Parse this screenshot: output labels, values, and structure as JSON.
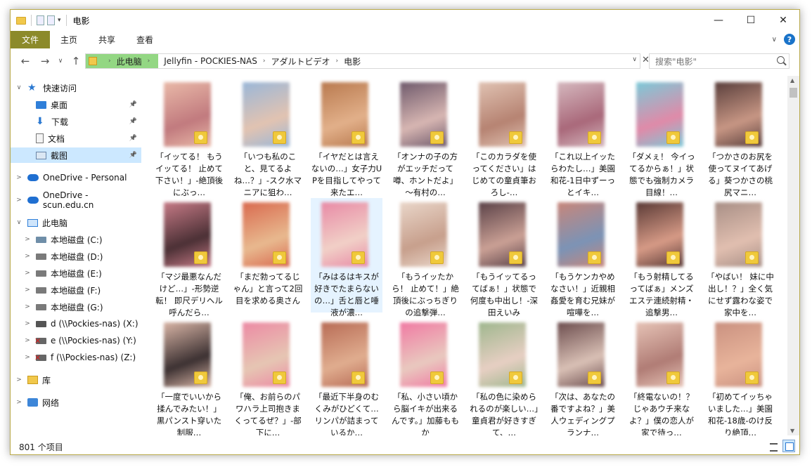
{
  "window": {
    "title": "电影",
    "controls": {
      "minimize": "—",
      "maximize": "☐",
      "close": "✕"
    }
  },
  "ribbon": {
    "tabs": [
      "文件",
      "主页",
      "共享",
      "查看"
    ],
    "help": "?"
  },
  "address": {
    "crumbs": [
      "此电脑",
      "Jellyfin - POCKIES-NAS",
      "アダルトビデオ",
      "电影"
    ],
    "search_placeholder": "搜索\"电影\""
  },
  "sidebar": {
    "items": [
      {
        "label": "快速访问",
        "icon": "star-icon",
        "expander": "∨",
        "pinned": false
      },
      {
        "label": "桌面",
        "icon": "desktop-icon",
        "pinned": true
      },
      {
        "label": "下载",
        "icon": "download-icon",
        "pinned": true
      },
      {
        "label": "文档",
        "icon": "document-icon",
        "pinned": true
      },
      {
        "label": "截图",
        "icon": "pictures-icon",
        "pinned": true,
        "selected": true
      },
      {
        "label": "OneDrive - Personal",
        "icon": "onedrive-icon",
        "expander": ">"
      },
      {
        "label": "OneDrive - scun.edu.cn",
        "icon": "onedrive-icon",
        "expander": ">"
      },
      {
        "label": "此电脑",
        "icon": "pc-icon",
        "expander": "∨"
      },
      {
        "label": "本地磁盘 (C:)",
        "icon": "windows-drive-icon",
        "expander": ">"
      },
      {
        "label": "本地磁盘 (D:)",
        "icon": "drive-icon",
        "expander": ">"
      },
      {
        "label": "本地磁盘 (E:)",
        "icon": "drive-icon",
        "expander": ">"
      },
      {
        "label": "本地磁盘 (F:)",
        "icon": "drive-icon",
        "expander": ">"
      },
      {
        "label": "本地磁盘 (G:)",
        "icon": "drive-icon",
        "expander": ">"
      },
      {
        "label": "d (\\\\Pockies-nas) (X:)",
        "icon": "network-drive-icon",
        "expander": ">"
      },
      {
        "label": "e (\\\\Pockies-nas) (Y:)",
        "icon": "disconnected-network-drive-icon",
        "expander": ">"
      },
      {
        "label": "f (\\\\Pockies-nas) (Z:)",
        "icon": "disconnected-network-drive-icon",
        "expander": ">"
      },
      {
        "label": "库",
        "icon": "library-icon",
        "expander": ">"
      },
      {
        "label": "网络",
        "icon": "network-icon",
        "expander": ">"
      }
    ]
  },
  "files": [
    {
      "caption": "「イッてる！ もうイッてる！ 止めて下さい！」-絶頂後にぶっ…",
      "colors": [
        "#e9b9a8",
        "#c17a7e"
      ]
    },
    {
      "caption": "「いつも私のこと、見てるよね…？」-スク水マニアに狙わ…",
      "colors": [
        "#9ab7d8",
        "#e2c3b1"
      ]
    },
    {
      "caption": "「イヤだとは言えないの…」女子力UPを目指してやって来たエ…",
      "colors": [
        "#b97a4f",
        "#e2b08a"
      ]
    },
    {
      "caption": "「オンナの子の方がエッチだって噂、ホントだよ」～有村の…",
      "colors": [
        "#6f5a6c",
        "#d7b6b2"
      ]
    },
    {
      "caption": "「このカラダを使ってください」はじめての童貞筆おろし-…",
      "colors": [
        "#e0c2b2",
        "#b68372"
      ]
    },
    {
      "caption": "「これ以上イッたらわたし…」美園和花-1日中ずーっとイキ…",
      "colors": [
        "#d5b8be",
        "#a9687a"
      ]
    },
    {
      "caption": "「ダメぇ！ 今イってるからぁ！」状態でも強制カメラ目線！…",
      "colors": [
        "#7cc9d8",
        "#e08aa8"
      ]
    },
    {
      "caption": "「つかさのお尻を使ってヌイてあげる」葵つかさの桃尻マニ…",
      "colors": [
        "#5a3f3c",
        "#c79684"
      ]
    },
    {
      "caption": "「マジ最悪なんだけど…」-形勢逆転！ 即尺デリヘル呼んだら…",
      "colors": [
        "#c67a86",
        "#4b3035"
      ]
    },
    {
      "caption": "「まだ勃ってるじゃん」と言って2回目を求める奥さん",
      "colors": [
        "#d96a4f",
        "#e8b98f"
      ]
    },
    {
      "caption": "「みはるはキスが好きでたまらないの…」舌と唇と唾液が濃…",
      "colors": [
        "#e88aa6",
        "#f1d0c7"
      ],
      "selected": true
    },
    {
      "caption": "「もうイッたから！ 止めて！」絶頂後にぶっちぎりの追撃弾…",
      "colors": [
        "#e9d6c9",
        "#c79f8c"
      ]
    },
    {
      "caption": "「もうイッてるってばぁ！」状態で何度も中出し！-深田えいみ",
      "colors": [
        "#5b4248",
        "#caa095"
      ]
    },
    {
      "caption": "「もうケンカやめなさい！」近親相姦愛を育む兄妹が喧嘩を…",
      "colors": [
        "#c8867a",
        "#7b93b6"
      ]
    },
    {
      "caption": "「もう射精してるってばぁ」メンズエステ連続射精・追撃男…",
      "colors": [
        "#5a3a36",
        "#d69a86"
      ]
    },
    {
      "caption": "「やばい！ 妹に中出し！？」全く気にせず露わな姿で家中を…",
      "colors": [
        "#a88f86",
        "#e1bfb0"
      ]
    },
    {
      "caption": "「一度でいいから揉んでみたい！」黒パンスト穿いた制服…",
      "colors": [
        "#d9b5a6",
        "#3c3132"
      ]
    },
    {
      "caption": "「俺、お前らのパワハラ上司抱きまくってるぜ？」-部下に…",
      "colors": [
        "#ec8aa4",
        "#e6c6b3"
      ]
    },
    {
      "caption": "「最近下半身のむくみがひどくて…リンパが詰まっているか…",
      "colors": [
        "#b86c56",
        "#e0ad8f"
      ]
    },
    {
      "caption": "「私、小さい頃から脳イキが出来るんです。」加藤ももか",
      "colors": [
        "#f07aa3",
        "#e9c9bf"
      ]
    },
    {
      "caption": "「私の色に染められるのが楽しい…」童貞君が好きすぎて、…",
      "colors": [
        "#9fb78e",
        "#e7cfc3"
      ]
    },
    {
      "caption": "「次は、あなたの番ですよね？」美人ウェディングプランナ…",
      "colors": [
        "#6d4e4f",
        "#d9c0b5"
      ]
    },
    {
      "caption": "「終電ないの！？ じゃあウチ来なよ？」僕の恋人が家で待っ…",
      "colors": [
        "#e6c3b6",
        "#b07c75"
      ]
    },
    {
      "caption": "「初めてイッちゃいました…」美園和花-18歳-のけ反り絶頂…",
      "colors": [
        "#ca9180",
        "#e8b49b"
      ]
    }
  ],
  "status": {
    "item_count": "801 个项目"
  }
}
